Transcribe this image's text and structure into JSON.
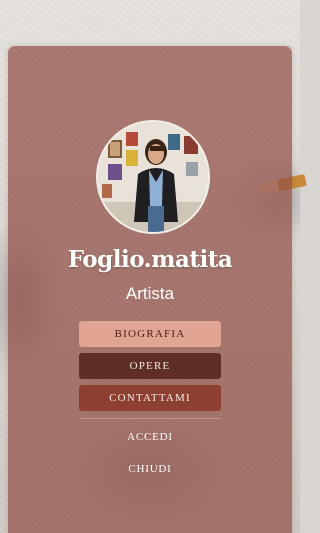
{
  "profile": {
    "name": "Foglio.matita",
    "role": "Artista"
  },
  "menu": {
    "biografia": "BIOGRAFIA",
    "opere": "OPERE",
    "contattami": "CONTATTAMI"
  },
  "actions": {
    "accedi": "ACCEDI",
    "chiudi": "CHIUDI"
  },
  "colors": {
    "card_overlay": "#925046",
    "biografia_button": "#e0a593",
    "opere_button": "#5f2f25",
    "contattami_button": "#8d3f32"
  }
}
